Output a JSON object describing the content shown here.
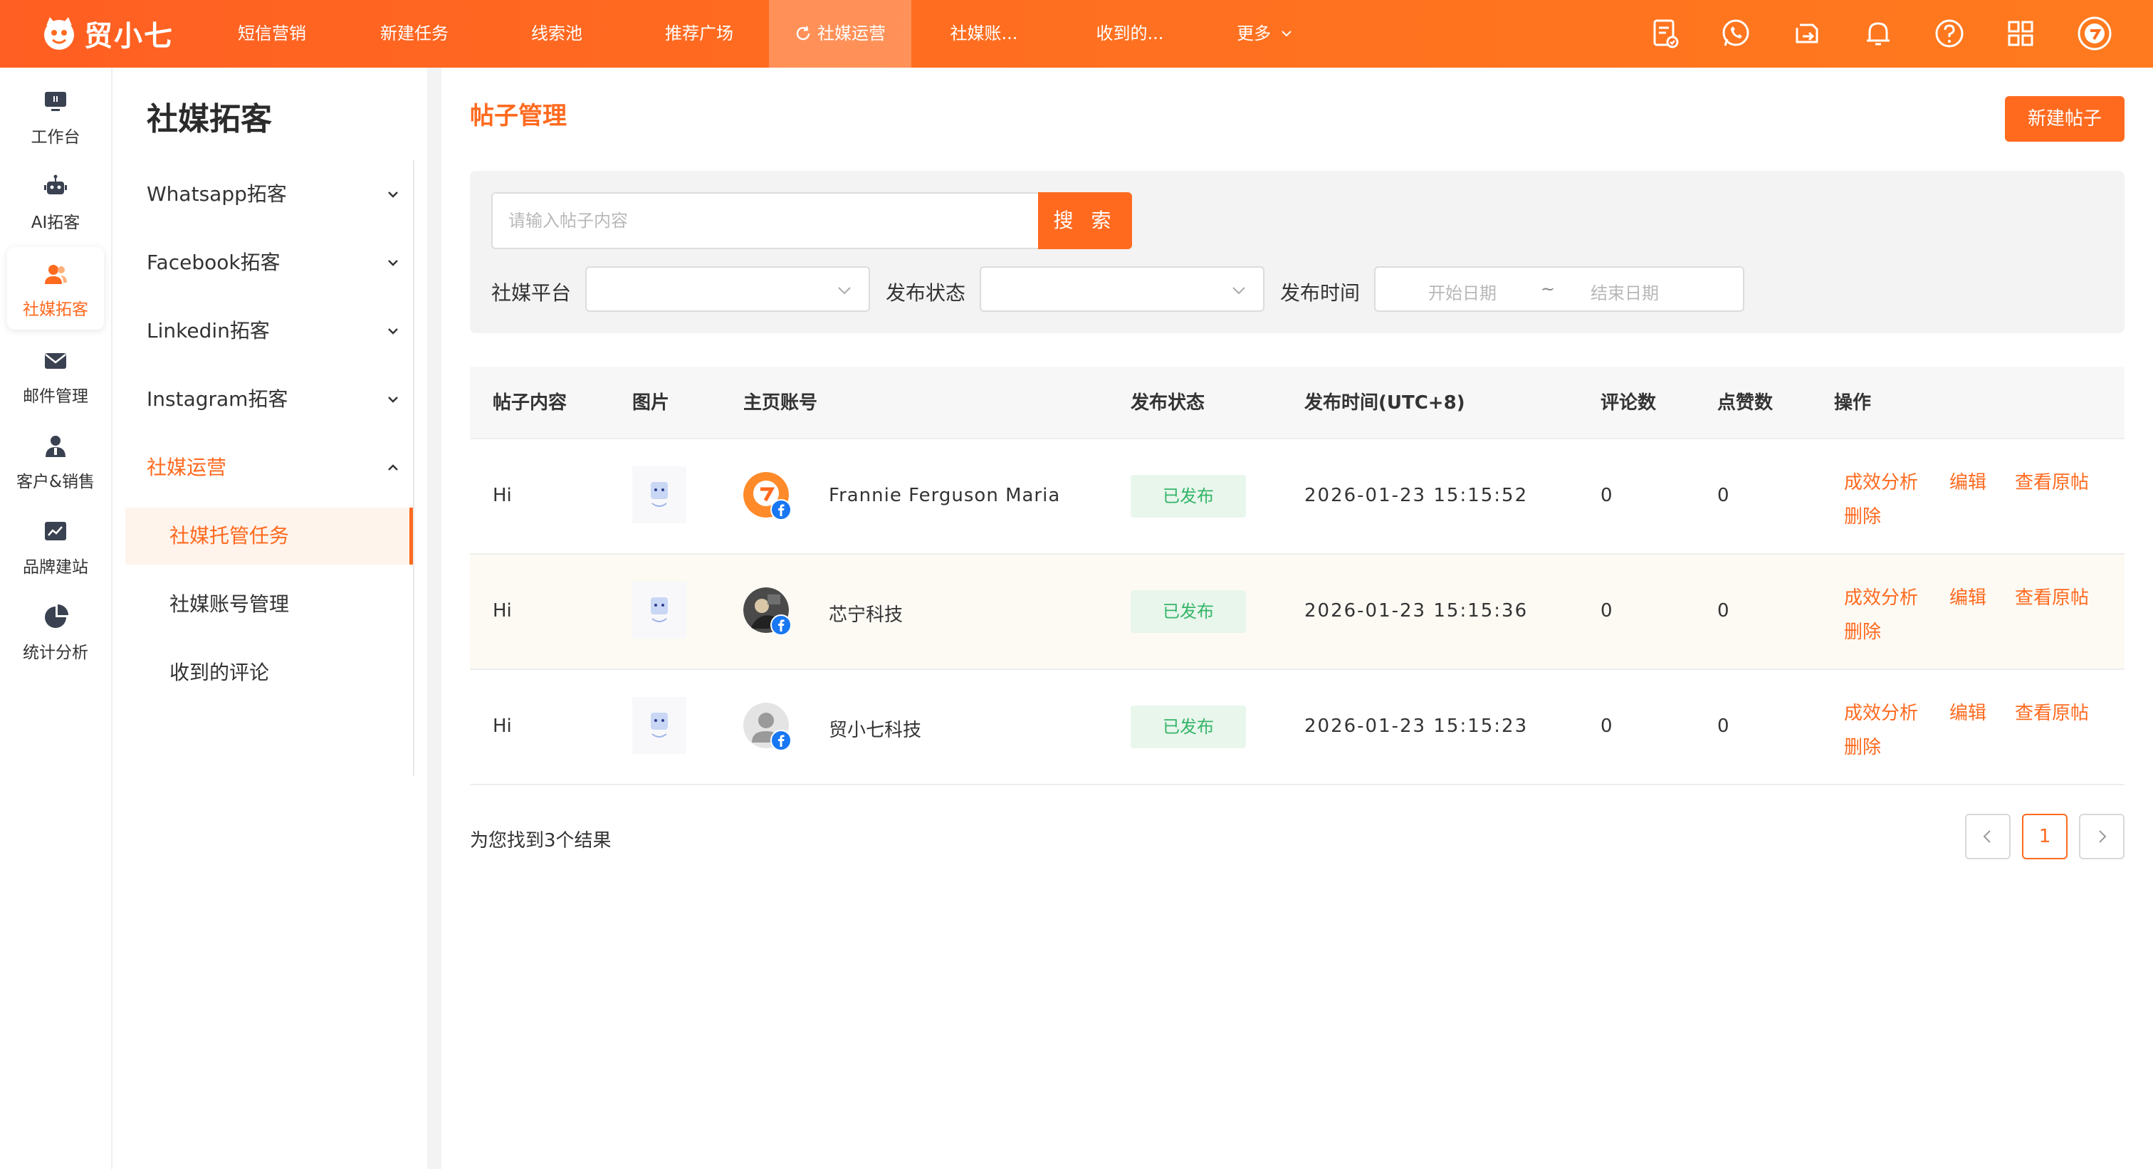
{
  "app": {
    "logo_text": "贸小七"
  },
  "top_nav": [
    {
      "label": "短信营销"
    },
    {
      "label": "新建任务"
    },
    {
      "label": "线索池"
    },
    {
      "label": "推荐广场"
    },
    {
      "label": "社媒运营"
    },
    {
      "label": "社媒账..."
    },
    {
      "label": "收到的..."
    },
    {
      "label": "更多"
    }
  ],
  "rail": [
    {
      "label": "工作台",
      "icon": "monitor-icon"
    },
    {
      "label": "AI拓客",
      "icon": "robot-icon"
    },
    {
      "label": "社媒拓客",
      "icon": "users-icon"
    },
    {
      "label": "邮件管理",
      "icon": "mail-icon"
    },
    {
      "label": "客户&销售",
      "icon": "person-icon"
    },
    {
      "label": "品牌建站",
      "icon": "chart-board-icon"
    },
    {
      "label": "统计分析",
      "icon": "pie-icon"
    }
  ],
  "submenu": {
    "title": "社媒拓客",
    "items": [
      {
        "label": "Whatsapp拓客"
      },
      {
        "label": "Facebook拓客"
      },
      {
        "label": "Linkedin拓客"
      },
      {
        "label": "Instagram拓客"
      },
      {
        "label": "社媒运营"
      }
    ],
    "children": [
      {
        "label": "社媒托管任务"
      },
      {
        "label": "社媒账号管理"
      },
      {
        "label": "收到的评论"
      }
    ]
  },
  "main": {
    "title": "帖子管理",
    "new_button": "新建帖子",
    "search": {
      "placeholder": "请输入帖子内容",
      "button": "搜 索"
    },
    "filters": {
      "platform_label": "社媒平台",
      "status_label": "发布状态",
      "time_label": "发布时间",
      "start_placeholder": "开始日期",
      "separator": "~",
      "end_placeholder": "结束日期"
    },
    "table": {
      "headers": [
        "帖子内容",
        "图片",
        "主页账号",
        "发布状态",
        "发布时间(UTC+8)",
        "评论数",
        "点赞数",
        "操作"
      ],
      "rows": [
        {
          "content": "Hi",
          "account": "Frannie Ferguson Maria",
          "status": "已发布",
          "time": "2026-01-23 15:15:52",
          "comments": "0",
          "likes": "0"
        },
        {
          "content": "Hi",
          "account": "芯宁科技",
          "status": "已发布",
          "time": "2026-01-23 15:15:36",
          "comments": "0",
          "likes": "0"
        },
        {
          "content": "Hi",
          "account": "贸小七科技",
          "status": "已发布",
          "time": "2026-01-23 15:15:23",
          "comments": "0",
          "likes": "0"
        }
      ],
      "actions": {
        "analyze": "成效分析",
        "edit": "编辑",
        "view": "查看原帖",
        "delete": "删除"
      }
    },
    "result_text": "为您找到3个结果",
    "pagination": {
      "current": "1"
    }
  },
  "colors": {
    "brand": "#ff6a1f",
    "published_bg": "#e8f6ec",
    "published_text": "#35b568"
  }
}
